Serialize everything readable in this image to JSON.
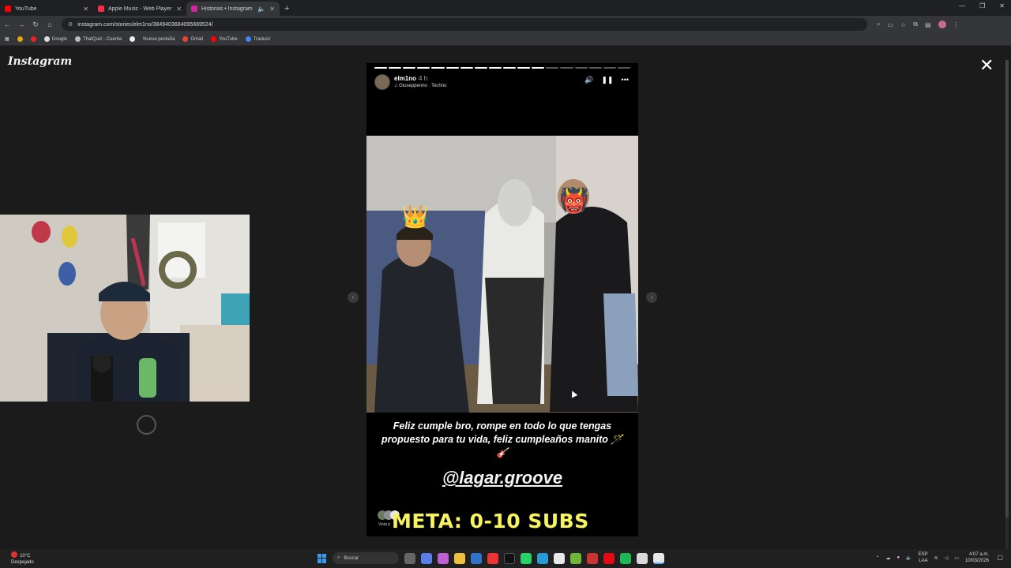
{
  "browser": {
    "tabs": [
      {
        "title": "YouTube",
        "color": "#ff0000",
        "active": false
      },
      {
        "title": "Apple Music - Web Player",
        "color": "#fa2d48",
        "active": false
      },
      {
        "title": "Historias • Instagram",
        "color": "#d6249f",
        "active": true
      }
    ],
    "url": "instagram.com/stories/elm1no/3849403684095669524/",
    "bookmarks": [
      "Google",
      "ThatQuiz - Cuenta",
      "Nueva pestaña",
      "Gmail",
      "YouTube",
      "Traducir"
    ]
  },
  "page": {
    "logo": "Instagram",
    "story": {
      "username": "elm1no",
      "time": "4 h",
      "music": "Giuseppenno · Techno",
      "segments_total": 18,
      "segments_done": 12,
      "caption": "Feliz cumple bro, rompe en todo lo que tengas propuesto para tu vida, feliz cumpleaños manito 🪄🎸",
      "mention": "@lagar.groove",
      "seen_label": "Vista p"
    },
    "overlay_banner": "META: 0-10 SUBS"
  },
  "taskbar": {
    "weather_temp": "10°C",
    "weather_desc": "Despejado",
    "search_label": "Buscar",
    "lang_top": "ESP",
    "lang_bottom": "LAA",
    "time": "4:07 a.m.",
    "date": "10/03/2026"
  }
}
